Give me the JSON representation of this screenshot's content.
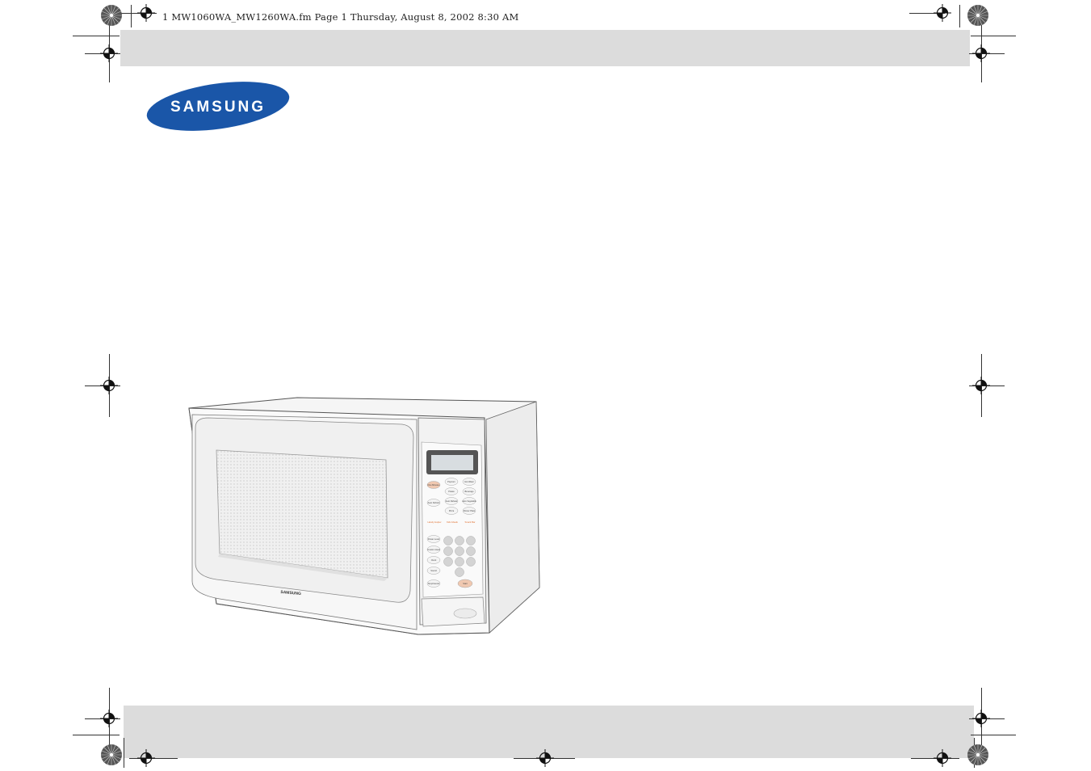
{
  "document": {
    "header_line": "1 MW1060WA_MW1260WA.fm  Page 1  Thursday, August 8, 2002  8:30 AM",
    "logo_text": "SAMSUNG",
    "microwave_brand_label": "SAMSUNG"
  },
  "microwave_panel": {
    "buttons_left": [
      "One Minute+",
      "Auto Defrost",
      "Power Level",
      "Custom Heat",
      "Clock",
      "Sound",
      "Stop/Cancel"
    ],
    "buttons_center": [
      "Popcorn",
      "Potato",
      "Auto Reheat",
      "Pizza"
    ],
    "buttons_right": [
      "Hot Water",
      "Beverage",
      "Auto Vegetable",
      "Dinner Plate"
    ],
    "special_buttons": [
      "Handy Helper",
      "Kids Meals",
      "Snack Bar"
    ],
    "start_label": "Start"
  },
  "colors": {
    "band_gray": "#dcdcdc",
    "logo_blue": "#1a56a8",
    "accent_orange": "#e07030"
  }
}
